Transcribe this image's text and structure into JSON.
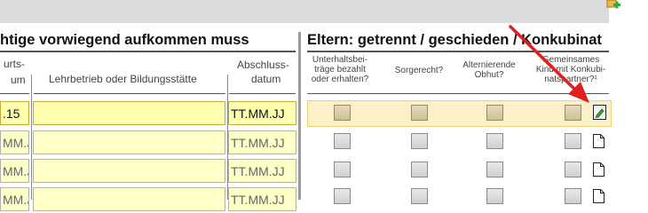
{
  "left_section": {
    "title": "htige vorwiegend aufkommen muss",
    "col_birth_line1": "urts-",
    "col_birth_line2": "um",
    "col_lehrbetrieb": "Lehrbetrieb oder Bildungsstätte",
    "col_abschluss_line1": "Abschluss-",
    "col_abschluss_line2": "datum",
    "rows": [
      {
        "birth": ".15",
        "lehrbetrieb": "",
        "abschluss": "TT.MM.JJ"
      },
      {
        "birth": "MM.JJ",
        "lehrbetrieb": "",
        "abschluss": "TT.MM.JJ"
      },
      {
        "birth": "MM.JJ",
        "lehrbetrieb": "",
        "abschluss": "TT.MM.JJ"
      },
      {
        "birth": "MM.JJ",
        "lehrbetrieb": "",
        "abschluss": "TT.MM.JJ"
      }
    ]
  },
  "right_section": {
    "title": "Eltern: getrennt / geschieden / Konkubinat",
    "col_unterhalt_l1": "Unterhaltsbei-",
    "col_unterhalt_l2": "träge bezahlt",
    "col_unterhalt_l3": "oder erhalten?",
    "col_sorgerecht": "Sorgerecht?",
    "col_obhut_l1": "Alternierende",
    "col_obhut_l2": "Obhut?",
    "col_gemeinsam_l1": "Gemeinsames",
    "col_gemeinsam_l2": "Kind mit Konkubi-",
    "col_gemeinsam_l3": "natspartner?¹"
  },
  "icons": {
    "corner": "add-folder-icon",
    "edit": "edit-document-icon",
    "doc": "document-icon",
    "annotation": "red-arrow"
  },
  "colors": {
    "input_bg": "#ffffc8",
    "highlight_row": "#fbf0c8",
    "arrow": "#e02020",
    "topbar": "#dcdcdc"
  }
}
